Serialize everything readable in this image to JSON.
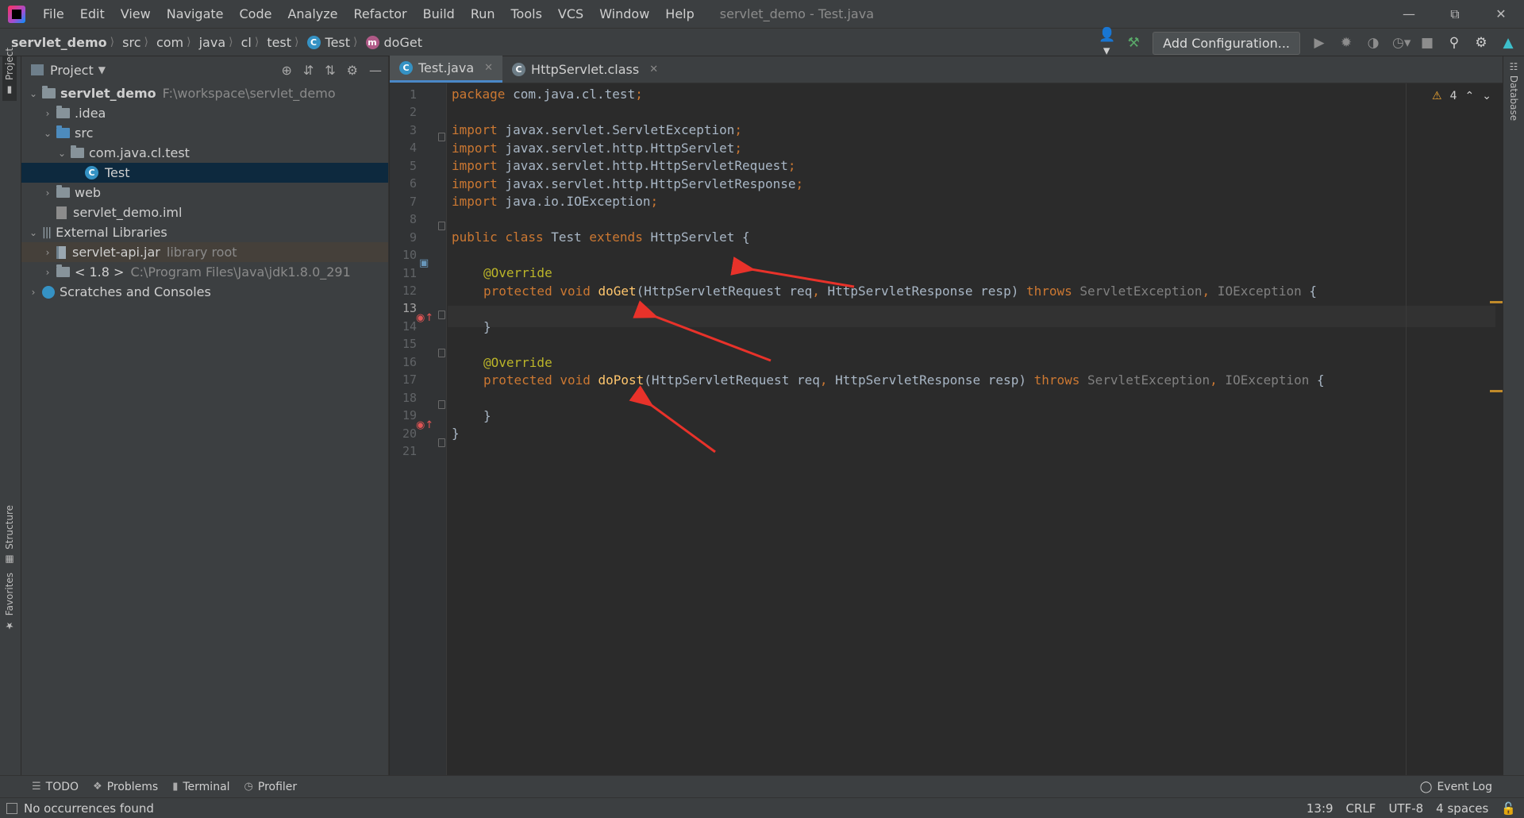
{
  "menubar": {
    "items": [
      "File",
      "Edit",
      "View",
      "Navigate",
      "Code",
      "Analyze",
      "Refactor",
      "Build",
      "Run",
      "Tools",
      "VCS",
      "Window",
      "Help"
    ],
    "window_title": "servlet_demo - Test.java"
  },
  "breadcrumbs": {
    "project": "servlet_demo",
    "items": [
      "src",
      "com",
      "java",
      "cl",
      "test"
    ],
    "class_name": "Test",
    "method_name": "doGet"
  },
  "toolbar": {
    "add_configuration": "Add Configuration..."
  },
  "side_tabs": {
    "project": "Project",
    "structure": "Structure",
    "favorites": "Favorites",
    "database": "Database"
  },
  "project_panel": {
    "title": "Project",
    "tree": [
      {
        "label": "servlet_demo",
        "hint": "F:\\workspace\\servlet_demo"
      },
      {
        "label": ".idea",
        "hint": ""
      },
      {
        "label": "src",
        "hint": ""
      },
      {
        "label": "com.java.cl.test",
        "hint": ""
      },
      {
        "label": "Test",
        "hint": ""
      },
      {
        "label": "web",
        "hint": ""
      },
      {
        "label": "servlet_demo.iml",
        "hint": ""
      },
      {
        "label": "External Libraries",
        "hint": ""
      },
      {
        "label": "servlet-api.jar",
        "hint": "library root"
      },
      {
        "label": "< 1.8 >",
        "hint": "C:\\Program Files\\Java\\jdk1.8.0_291"
      },
      {
        "label": "Scratches and Consoles",
        "hint": ""
      }
    ]
  },
  "editor": {
    "tabs": [
      {
        "label": "Test.java",
        "badge": "C"
      },
      {
        "label": "HttpServlet.class",
        "badge": "C"
      }
    ],
    "warnings_count": "4",
    "line_numbers": [
      "1",
      "2",
      "3",
      "4",
      "5",
      "6",
      "7",
      "8",
      "9",
      "10",
      "11",
      "12",
      "13",
      "14",
      "15",
      "16",
      "17",
      "18",
      "19",
      "20",
      "21"
    ],
    "current_line": 13,
    "code": {
      "l1_kw": "package",
      "l1_rest": " com.java.cl.test",
      "l1_end": ";",
      "l3_kw": "import",
      "l3_rest": " javax.servlet.ServletException",
      "l4_kw": "import",
      "l4_rest": " javax.servlet.http.HttpServlet",
      "l5_kw": "import",
      "l5_rest": " javax.servlet.http.HttpServletRequest",
      "l6_kw": "import",
      "l6_rest": " javax.servlet.http.HttpServletResponse",
      "l7_kw": "import",
      "l7_rest": " java.io.IOException",
      "semicolon": ";",
      "l9_kw1": "public class",
      "l9_name": " Test ",
      "l9_kw2": "extends",
      "l9_rest": " HttpServlet {",
      "override": "@Override",
      "l12_kw": "protected void ",
      "l12_fn": "doGet",
      "l12_params": "(HttpServletRequest req",
      "comma": ",",
      "l12_params2": " HttpServletResponse resp) ",
      "throws": "throws",
      "ex1": " ServletException",
      "ex2": " IOException",
      "open_brace": " {",
      "close_inner": "}",
      "l17_fn": "doPost",
      "close_outer": "}"
    }
  },
  "bottom_tools": {
    "todo": "TODO",
    "problems": "Problems",
    "terminal": "Terminal",
    "profiler": "Profiler",
    "event_log": "Event Log"
  },
  "statusbar": {
    "message": "No occurrences found",
    "position": "13:9",
    "line_sep": "CRLF",
    "encoding": "UTF-8",
    "indent": "4 spaces"
  },
  "colors": {
    "annotation_arrows": "#e8322a",
    "selection": "#0d293e",
    "keyword": "#cc7832"
  }
}
